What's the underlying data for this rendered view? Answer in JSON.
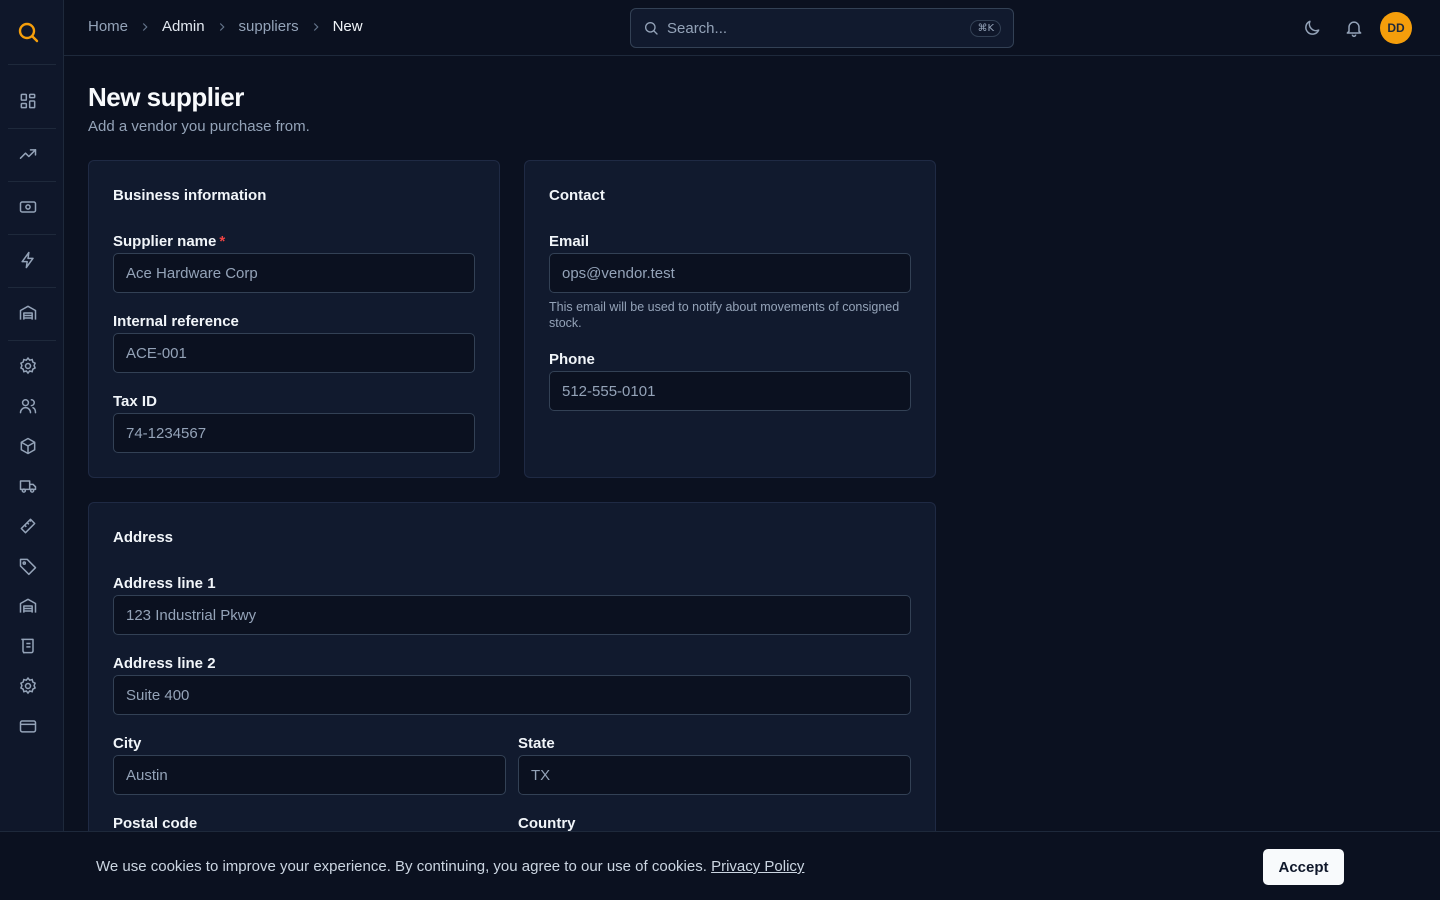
{
  "breadcrumb": {
    "home": "Home",
    "admin": "Admin",
    "suppliers": "suppliers",
    "current": "New"
  },
  "search": {
    "placeholder": "Search...",
    "shortcut": "⌘K"
  },
  "user": {
    "initials": "DD"
  },
  "page": {
    "title": "New supplier",
    "subtitle": "Add a vendor you purchase from."
  },
  "business": {
    "title": "Business information",
    "supplier_name_label": "Supplier name",
    "supplier_name_required": "*",
    "supplier_name_value": "Ace Hardware Corp",
    "internal_ref_label": "Internal reference",
    "internal_ref_value": "ACE-001",
    "tax_id_label": "Tax ID",
    "tax_id_value": "74-1234567"
  },
  "contact": {
    "title": "Contact",
    "email_label": "Email",
    "email_value": "ops@vendor.test",
    "email_help": "This email will be used to notify about movements of consigned stock.",
    "phone_label": "Phone",
    "phone_value": "512-555-0101"
  },
  "address": {
    "title": "Address",
    "line1_label": "Address line 1",
    "line1_value": "123 Industrial Pkwy",
    "line2_label": "Address line 2",
    "line2_value": "Suite 400",
    "city_label": "City",
    "city_value": "Austin",
    "state_label": "State",
    "state_value": "TX",
    "postal_label": "Postal code",
    "country_label": "Country"
  },
  "cookie": {
    "text": "We use cookies to improve your experience. By continuing, you agree to our use of cookies.",
    "link": "Privacy Policy",
    "accept": "Accept"
  },
  "colors": {
    "accent": "#f59e0b",
    "background": "#0b1120",
    "card": "#111a2e",
    "required": "#ef4444"
  }
}
